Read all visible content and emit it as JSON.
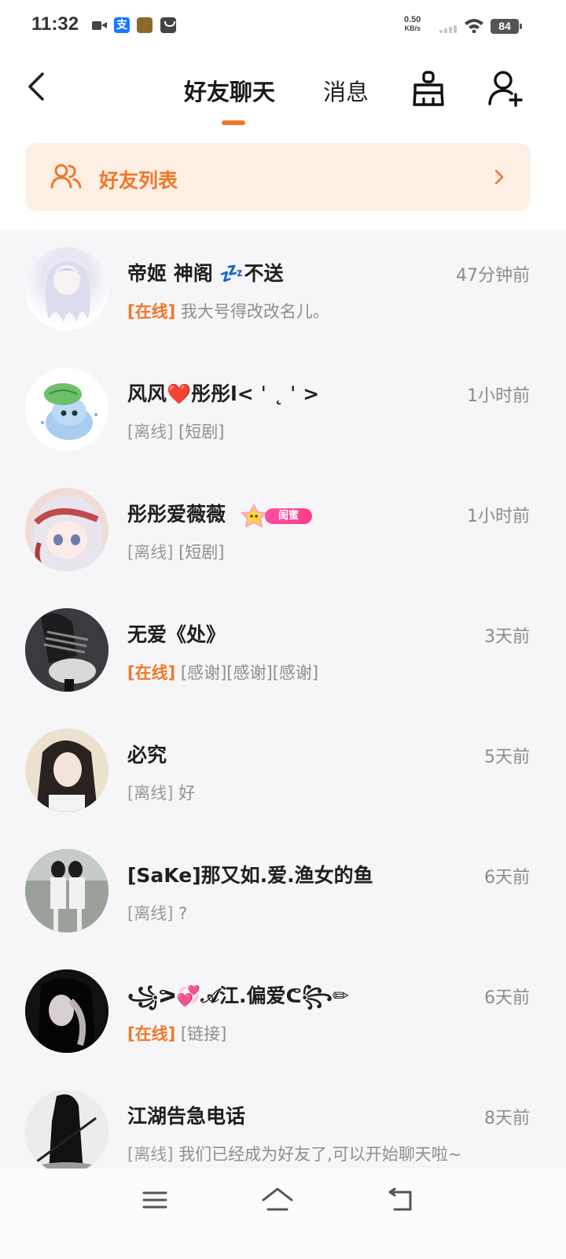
{
  "status_bar": {
    "time": "11:32",
    "net_speed_value": "0.50",
    "net_speed_unit": "KB/s",
    "battery": "84",
    "alipay_glyph": "支"
  },
  "header": {
    "tabs": [
      {
        "label": "好友聊天",
        "active": true
      },
      {
        "label": "消息",
        "active": false
      }
    ],
    "accent_color": "#f0782a"
  },
  "banner": {
    "label": "好友列表",
    "background": "#fdefe4"
  },
  "friends": [
    {
      "name": "帝姬  神阁 💤不送",
      "time": "47分钟前",
      "status": "[在线]",
      "online": true,
      "message": " 我大号得改改名儿。",
      "avatar": "white-hair-doll-avatar"
    },
    {
      "name": "风风❤️彤彤l< ˈ ˛ ˈ >",
      "time": "1小时前",
      "status": "[离线]",
      "online": false,
      "message": " [短剧]",
      "avatar": "cartoon-leaf-creature-avatar"
    },
    {
      "name": "彤彤爱薇薇",
      "time": "1小时前",
      "status": "[离线]",
      "online": false,
      "message": " [短剧]",
      "avatar": "anime-girl-avatar",
      "badge": "闺蜜"
    },
    {
      "name": "无爱《处》",
      "time": "3天前",
      "status": "[在线]",
      "online": true,
      "message": " [感谢][感谢][感谢]",
      "avatar": "dark-photo-avatar"
    },
    {
      "name": "必究",
      "time": "5天前",
      "status": "[离线]",
      "online": false,
      "message": " 好",
      "avatar": "girl-portrait-avatar"
    },
    {
      "name": "[SaKe]那又如.爱.渔女的鱼",
      "time": "6天前",
      "status": "[离线]",
      "online": false,
      "message": " ?",
      "avatar": "two-girls-photo-avatar"
    },
    {
      "name": "꧁ᕗ💞𝒜江.偏爱ᕦ꧂✏",
      "time": "6天前",
      "status": "[在线]",
      "online": true,
      "message": " [链接]",
      "avatar": "dark-girl-portrait-avatar"
    },
    {
      "name": "江湖告急电话",
      "time": "8天前",
      "status": "[离线]",
      "online": false,
      "message": " 我们已经成为好友了,可以开始聊天啦~",
      "avatar": "black-white-swordsman-avatar"
    }
  ]
}
